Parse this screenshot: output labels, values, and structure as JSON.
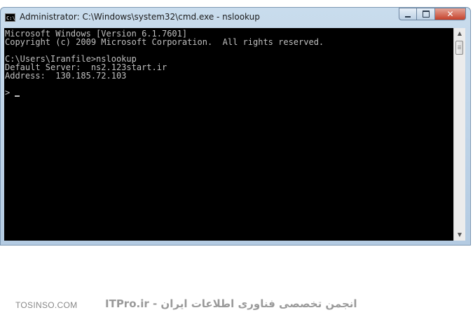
{
  "window": {
    "title": "Administrator: C:\\Windows\\system32\\cmd.exe - nslookup",
    "app_icon_text": "C:\\",
    "buttons": {
      "minimize": "minimize-icon",
      "maximize": "maximize-icon",
      "close": "✕"
    }
  },
  "console": {
    "lines": [
      "Microsoft Windows [Version 6.1.7601]",
      "Copyright (c) 2009 Microsoft Corporation.  All rights reserved.",
      "",
      "C:\\Users\\Iranfile>nslookup",
      "Default Server:  ns2.123start.ir",
      "Address:  130.185.72.103",
      "",
      ">"
    ],
    "colors": {
      "background": "#000000",
      "text": "#c0c0c0"
    }
  },
  "scrollbar": {
    "up_arrow": "▲",
    "down_arrow": "▼"
  },
  "watermark": {
    "site": "TOSINSO.COM",
    "brand": "ITPro.ir - انجمن تخصصی فناوری اطلاعات ایران"
  }
}
